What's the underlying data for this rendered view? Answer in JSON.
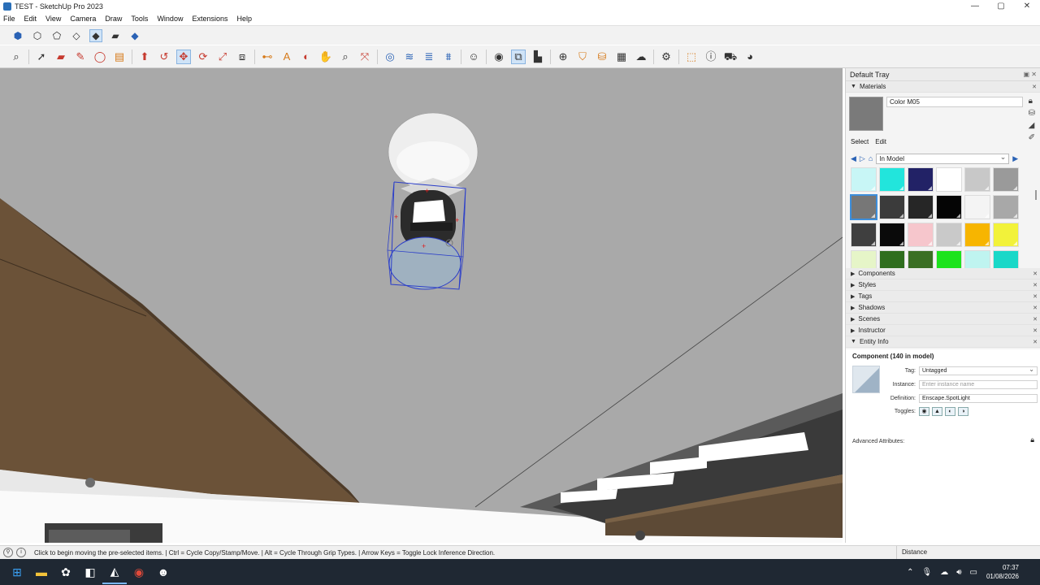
{
  "window": {
    "title": "TEST - SketchUp Pro 2023",
    "controls": [
      "—",
      "▢",
      "✕"
    ]
  },
  "menu": [
    "File",
    "Edit",
    "View",
    "Camera",
    "Draw",
    "Tools",
    "Window",
    "Extensions",
    "Help"
  ],
  "tray": {
    "title": "Default Tray",
    "materials": {
      "header": "Materials",
      "current_name": "Color M05",
      "tab_select": "Select",
      "tab_edit": "Edit",
      "collection": "In Model",
      "swatches": [
        "#c8f6f6",
        "#22e5dc",
        "#222266",
        "#ffffff",
        "#c8c8c8",
        "#9a9a9a",
        "#777777",
        "#3b3b3b",
        "#262626",
        "#050505",
        "#f4f4f4",
        "#a8a8a8",
        "#3f3f3f",
        "#0a0a0a",
        "#f6c6cc",
        "#c9c9c9",
        "#f7b500",
        "#f2f23a",
        "#e6f5c8",
        "#2f6e1e",
        "#3b6f24",
        "#1de31d",
        "#bff4f0",
        "#1ad8c8"
      ]
    },
    "sections": [
      "Components",
      "Styles",
      "Tags",
      "Shadows",
      "Scenes",
      "Instructor"
    ],
    "entity_info": {
      "header": "Entity Info",
      "heading": "Component (140 in model)",
      "tag_label": "Tag:",
      "tag_value": "Untagged",
      "instance_label": "Instance:",
      "instance_placeholder": "Enter instance name",
      "definition_label": "Definition:",
      "definition_value": "Enscape.SpotLight",
      "toggles_label": "Toggles:",
      "advanced": "Advanced Attributes:"
    }
  },
  "status": {
    "message": "Click to begin moving the pre-selected items.  |  Ctrl = Cycle Copy/Stamp/Move.  |  Alt = Cycle Through Grip Types.  |  Arrow Keys = Toggle Lock Inference Direction.",
    "measurement_label": "Distance"
  },
  "taskbar": {
    "time": "07:37",
    "date": "01/08/2026"
  },
  "colors": {
    "selection": "#2b3ec9",
    "wall_brown": "#6b5238",
    "ceiling_gray": "#a9a9a9"
  }
}
